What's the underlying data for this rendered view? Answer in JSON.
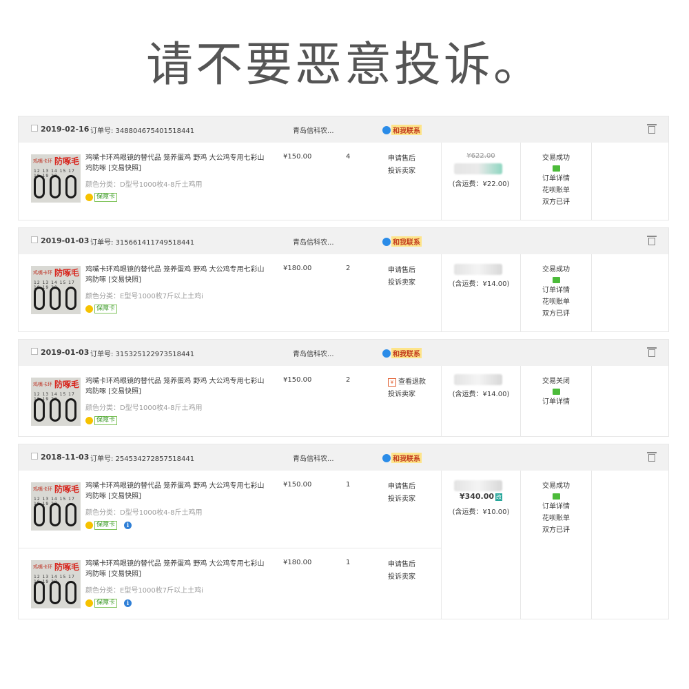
{
  "headline": "请不要恶意投诉。",
  "orders": [
    {
      "date": "2019-02-16",
      "order_no": "订单号: 348804675401518441",
      "shop": "青岛信科农...",
      "contact": "和我联系",
      "items": [
        {
          "title": "鸡嘴卡环鸡眼镜的替代品 笼养蛋鸡 野鸡 大公鸡专用七彩山鸡防啄 [交易快照]",
          "sku": "颜色分类：D型号1000枚4-8斤土鸡用",
          "guard": "保障卡",
          "price": "¥150.00",
          "qty": "4",
          "svc1": "申请售后",
          "svc2": "投诉卖家",
          "thumb": {
            "tl": "鸡嘴卡环",
            "tr": "防啄毛",
            "nums": "12 13 14 15 17 18 19 20"
          }
        }
      ],
      "pay": {
        "orig": "¥622.00",
        "ship": "(含运费：¥22.00)"
      },
      "status": [
        "交易成功",
        "订单详情",
        "花呗账单",
        "双方已评"
      ]
    },
    {
      "date": "2019-01-03",
      "order_no": "订单号: 315661411749518441",
      "shop": "青岛信科农...",
      "contact": "和我联系",
      "items": [
        {
          "title": "鸡嘴卡环鸡眼镜的替代品 笼养蛋鸡 野鸡 大公鸡专用七彩山鸡防啄 [交易快照]",
          "sku": "颜色分类：E型号1000枚7斤以上土鸡i",
          "guard": "保障卡",
          "price": "¥180.00",
          "qty": "2",
          "svc1": "申请售后",
          "svc2": "投诉卖家",
          "thumb": {
            "tl": "鸡嘴卡环",
            "tr": "防啄毛",
            "nums": "12 13 14 15 17 18 19 20"
          }
        }
      ],
      "pay": {
        "ship": "(含运费：¥14.00)"
      },
      "status": [
        "交易成功",
        "订单详情",
        "花呗账单",
        "双方已评"
      ]
    },
    {
      "date": "2019-01-03",
      "order_no": "订单号: 315325122973518441",
      "shop": "青岛信科农...",
      "contact": "和我联系",
      "items": [
        {
          "title": "鸡嘴卡环鸡眼镜的替代品 笼养蛋鸡 野鸡 大公鸡专用七彩山鸡防啄 [交易快照]",
          "sku": "颜色分类：D型号1000枚4-8斤土鸡用",
          "guard": "保障卡",
          "price": "¥150.00",
          "qty": "2",
          "svc1": "查看退款",
          "svc2": "投诉卖家",
          "thumb": {
            "tl": "鸡嘴卡环",
            "tr": "防啄毛",
            "nums": "12 13 14 15 17 18 19 20"
          }
        }
      ],
      "pay": {
        "ship": "(含运费：¥14.00)"
      },
      "status": [
        "交易关闭",
        "订单详情"
      ]
    },
    {
      "date": "2018-11-03",
      "order_no": "订单号: 254534272857518441",
      "shop": "青岛信科农...",
      "contact": "和我联系",
      "items": [
        {
          "title": "鸡嘴卡环鸡眼镜的替代品 笼养蛋鸡 野鸡 大公鸡专用七彩山鸡防啄 [交易快照]",
          "sku": "颜色分类：D型号1000枚4-8斤土鸡用",
          "guard": "保障卡",
          "price": "¥150.00",
          "qty": "1",
          "svc1": "申请售后",
          "svc2": "投诉卖家",
          "thumb": {
            "tl": "鸡嘴卡环",
            "tr": "防啄毛",
            "nums": "12 13 14 15 17 18 19 20"
          }
        },
        {
          "title": "鸡嘴卡环鸡眼镜的替代品 笼养蛋鸡 野鸡 大公鸡专用七彩山鸡防啄 [交易快照]",
          "sku": "颜色分类：E型号1000枚7斤以上土鸡i",
          "guard": "保障卡",
          "price": "¥180.00",
          "qty": "1",
          "svc1": "申请售后",
          "svc2": "投诉卖家",
          "thumb": {
            "tl": "鸡嘴卡环",
            "tr": "防啄毛",
            "nums": "12 13 14 15 17 18 19 20"
          }
        }
      ],
      "pay": {
        "total": "¥340.00",
        "gai": "改",
        "ship": "(含运费：¥10.00)"
      },
      "status": [
        "交易成功",
        "订单详情",
        "花呗账单",
        "双方已评"
      ]
    }
  ],
  "info_glyph": "i",
  "refund_glyph": "¥",
  "colors": {
    "header_bg": "#f1f1f1",
    "contact_tag_bg": "#fde48a",
    "contact_tag_text": "#c23b1e",
    "guard_green": "#3d9a2a",
    "chat_green": "#4cbb3a"
  },
  "icons": [
    "checkbox-icon",
    "trash-icon",
    "contact-icon",
    "guard-card-icon",
    "chat-icon",
    "info-icon",
    "refund-icon"
  ]
}
